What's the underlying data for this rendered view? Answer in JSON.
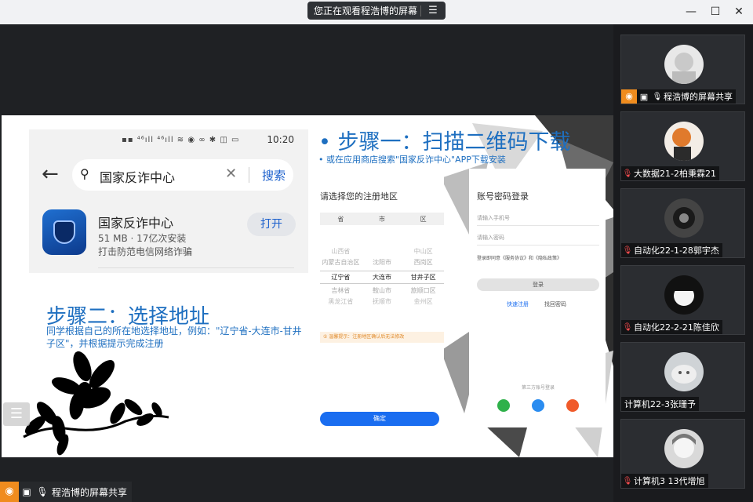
{
  "window": {
    "share_banner": "您正在观看程浩博的屏幕",
    "menu_icon": "list-icon",
    "minimize_icon": "minimize-icon",
    "maximize_icon": "maximize-icon",
    "close_icon": "close-icon"
  },
  "slide": {
    "step1_title": "•  步骤一：扫描二维码下载",
    "step1_sub": "•    或在应用商店搜索\"国家反诈中心\"APP下载安装",
    "step2_title": "步骤二：选择地址",
    "step2_body": "同学根据自己的所在地选择地址，例如：\"辽宁省-大连市-甘井子区\"，并根据提示完成注册",
    "phone": {
      "time": "10:20",
      "search_query": "国家反诈中心",
      "search_button": "搜索",
      "app_name": "国家反诈中心",
      "app_meta": "51 MB · 17亿次安装",
      "app_desc": "打击防范电信网络诈骗",
      "open_button": "打开"
    },
    "region_screen": {
      "title": "请选择您的注册地区",
      "columns": [
        "省",
        "市",
        "区"
      ],
      "rows": [
        [
          "山西省",
          "",
          "中山区"
        ],
        [
          "内蒙古自治区",
          "沈阳市",
          "西岗区"
        ],
        [
          "辽宁省",
          "大连市",
          "甘井子区"
        ],
        [
          "吉林省",
          "鞍山市",
          "旅顺口区"
        ],
        [
          "黑龙江省",
          "抚顺市",
          "金州区"
        ]
      ],
      "warning": "① 温馨提示：注册地区确认后无法修改",
      "confirm": "确定"
    },
    "login_screen": {
      "title": "账号密码登录",
      "phone_placeholder": "请输入手机号",
      "password_placeholder": "请输入密码",
      "agree_text": "登录即同意《服务协议》和《隐私政策》",
      "login_button": "登录",
      "register_link": "快速注册",
      "forgot_link": "找回密码",
      "third_party": "第三方账号登录"
    }
  },
  "presenter_tag": {
    "name": "程浩博的屏幕共享"
  },
  "participants": [
    {
      "name": "程浩博的屏幕共享",
      "sharing": true,
      "mic": "on"
    },
    {
      "name": "大数据21-2柏秉霖21",
      "sharing": false,
      "mic": "off"
    },
    {
      "name": "自动化22-1-28郭宇杰",
      "sharing": false,
      "mic": "off"
    },
    {
      "name": "自动化22-2-21陈佳欣",
      "sharing": false,
      "mic": "off"
    },
    {
      "name": "计算机22-3张珊予",
      "sharing": false,
      "mic": "none"
    },
    {
      "name": "计算机3 13代增旭",
      "sharing": false,
      "mic": "off"
    }
  ],
  "colors": {
    "accent_blue": "#1e6fc0",
    "share_orange": "#f08c1e",
    "muted_red": "#ff4d4f"
  }
}
